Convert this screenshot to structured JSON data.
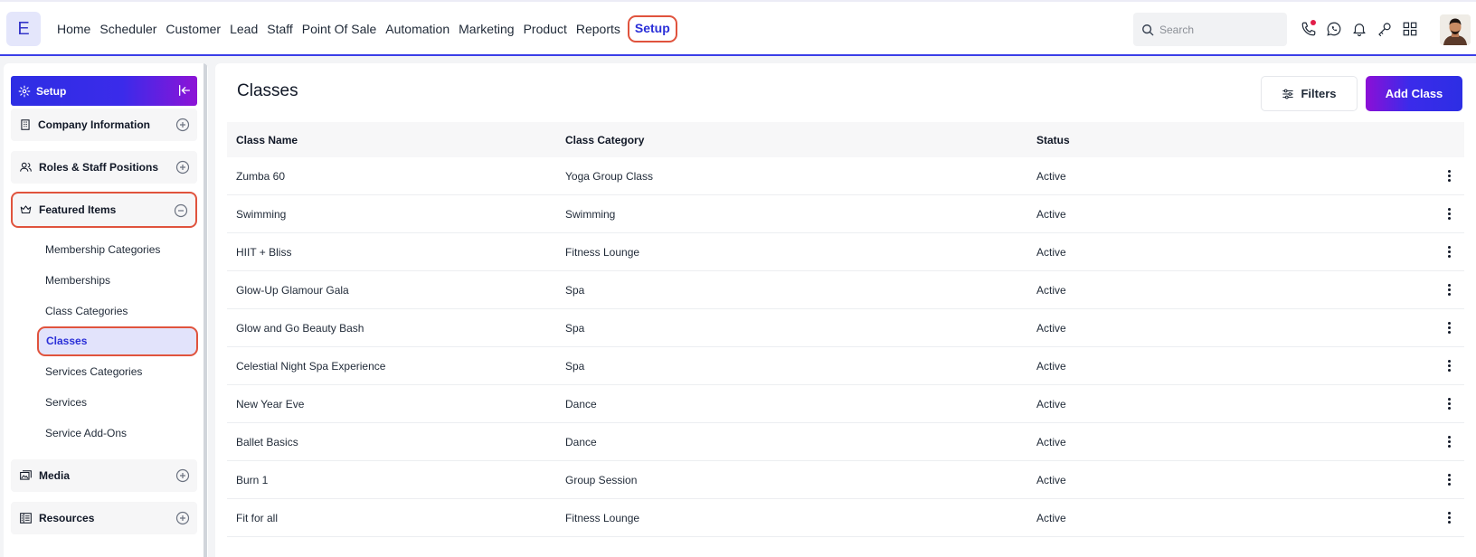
{
  "logo": {
    "letter": "E"
  },
  "nav": {
    "items": [
      "Home",
      "Scheduler",
      "Customer",
      "Lead",
      "Staff",
      "Point Of Sale",
      "Automation",
      "Marketing",
      "Product",
      "Reports"
    ],
    "active": "Setup"
  },
  "search": {
    "placeholder": "Search"
  },
  "top_icons": [
    "phone-icon",
    "whatsapp-icon",
    "bell-icon",
    "key-icon",
    "apps-grid-icon"
  ],
  "sidebar": {
    "header": "Setup",
    "sections": [
      {
        "label": "Company Information",
        "icon": "building-icon",
        "toggle": "expand"
      },
      {
        "label": "Roles & Staff Positions",
        "icon": "users-icon",
        "toggle": "expand"
      },
      {
        "label": "Featured Items",
        "icon": "crown-icon",
        "toggle": "collapse"
      },
      {
        "label": "Media",
        "icon": "media-icon",
        "toggle": "expand"
      },
      {
        "label": "Resources",
        "icon": "resources-icon",
        "toggle": "expand"
      }
    ],
    "featured_sub_items": [
      "Membership Categories",
      "Memberships",
      "Class Categories",
      "Classes",
      "Services Categories",
      "Services",
      "Service Add-Ons"
    ],
    "active_sub_item": "Classes"
  },
  "main": {
    "title": "Classes",
    "filters_label": "Filters",
    "add_label": "Add Class",
    "columns": [
      "Class Name",
      "Class Category",
      "Status"
    ],
    "rows": [
      [
        "Zumba 60",
        "Yoga Group Class",
        "Active"
      ],
      [
        "Swimming",
        "Swimming",
        "Active"
      ],
      [
        "HIIT + Bliss",
        "Fitness Lounge",
        "Active"
      ],
      [
        "Glow-Up Glamour Gala",
        "Spa",
        "Active"
      ],
      [
        "Glow and Go Beauty Bash",
        "Spa",
        "Active"
      ],
      [
        "Celestial Night Spa Experience",
        "Spa",
        "Active"
      ],
      [
        "New Year Eve",
        "Dance",
        "Active"
      ],
      [
        "Ballet Basics",
        "Dance",
        "Active"
      ],
      [
        "Burn 1",
        "Group Session",
        "Active"
      ],
      [
        "Fit for all",
        "Fitness Lounge",
        "Active"
      ]
    ]
  },
  "colors": {
    "accent": "#2a2fd8",
    "highlight_outline": "#e0533d",
    "gradient_end": "#8c0fd6"
  }
}
